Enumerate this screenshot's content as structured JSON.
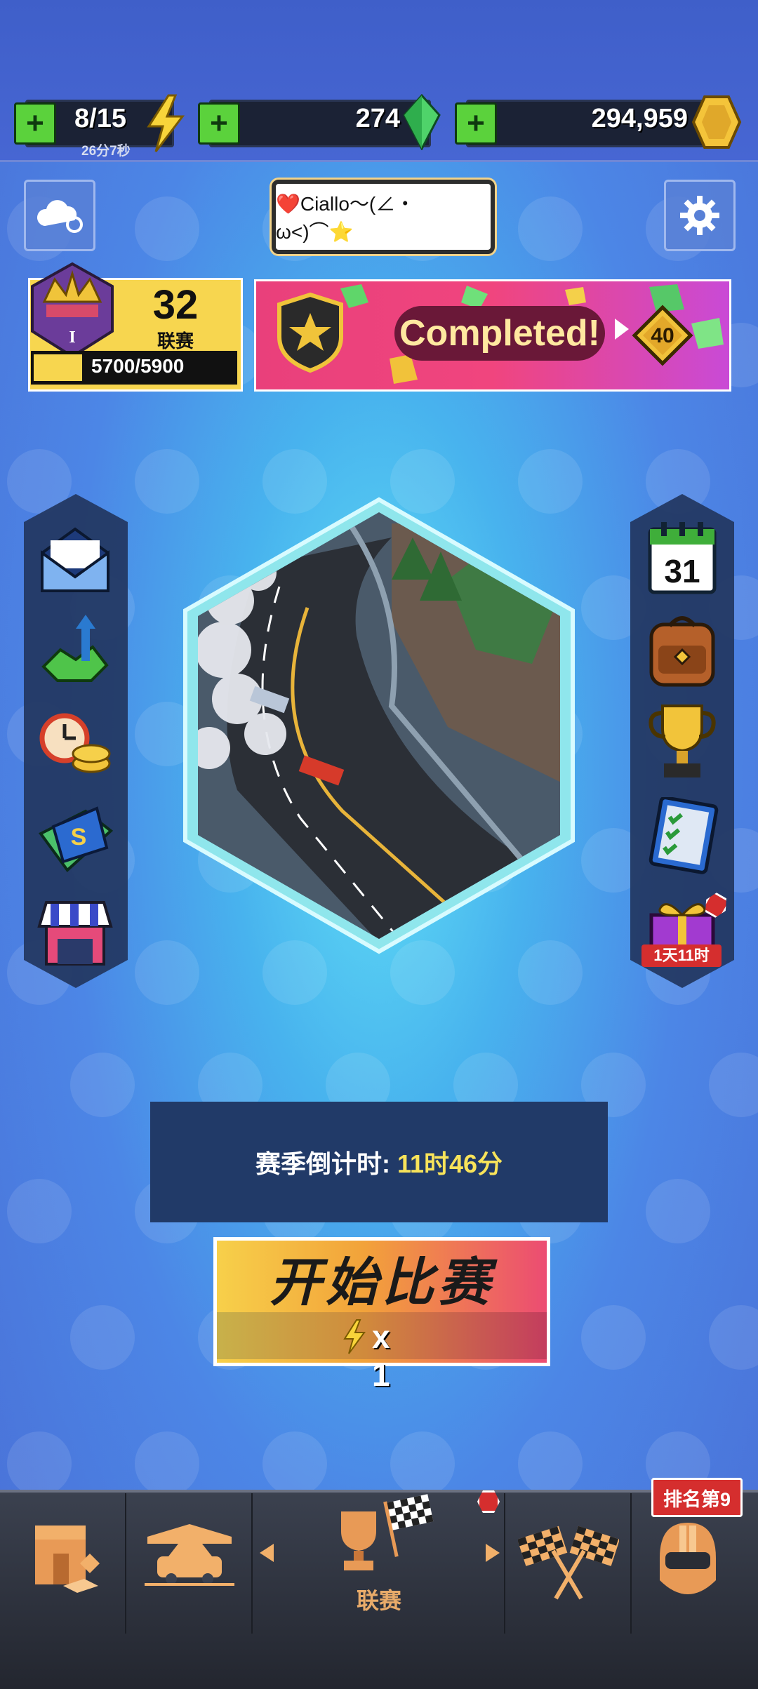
{
  "resources": {
    "energy": {
      "value": "8/15",
      "timer": "26分7秒"
    },
    "gems": {
      "value": "274"
    },
    "coins": {
      "value": "294,959"
    }
  },
  "header": {
    "nickname": "❤️Ciallo～(∠・ω<)⌒⭐"
  },
  "league": {
    "number": "32",
    "label": "联赛",
    "xp": "5700/5900",
    "xp_progress": 0.966,
    "rank_roman": "I"
  },
  "banner": {
    "status": "Completed!",
    "level": "40"
  },
  "left_menu": [
    "mail-icon",
    "gem-upgrade-icon",
    "timed-coins-icon",
    "card-pack-icon",
    "shop-icon"
  ],
  "right_menu": {
    "calendar_day": "31",
    "gift_timer": "1天11时"
  },
  "countdown": {
    "label": "赛季倒计时:",
    "value": "11时46分"
  },
  "start_button": {
    "title": "开始比赛",
    "cost": "x 1"
  },
  "bottom_nav": {
    "active_label": "联赛",
    "rank_badge": "排名第9"
  },
  "colors": {
    "accent_green": "#5bd23c",
    "energy_yellow": "#f8d43a",
    "badge_red": "#d52e2e",
    "nav_label": "#e8ab6a"
  }
}
